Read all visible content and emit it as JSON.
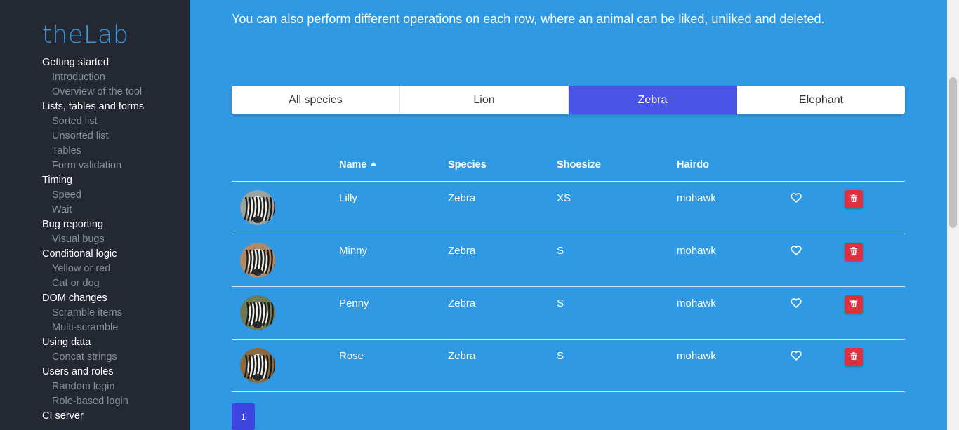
{
  "brand": "theLab",
  "nav": [
    {
      "section": "Getting started",
      "items": [
        "Introduction",
        "Overview of the tool"
      ]
    },
    {
      "section": "Lists, tables and forms",
      "items": [
        "Sorted list",
        "Unsorted list",
        "Tables",
        "Form validation"
      ]
    },
    {
      "section": "Timing",
      "items": [
        "Speed",
        "Wait"
      ]
    },
    {
      "section": "Bug reporting",
      "items": [
        "Visual bugs"
      ]
    },
    {
      "section": "Conditional logic",
      "items": [
        "Yellow or red",
        "Cat or dog"
      ]
    },
    {
      "section": "DOM changes",
      "items": [
        "Scramble items",
        "Multi-scramble"
      ]
    },
    {
      "section": "Using data",
      "items": [
        "Concat strings"
      ]
    },
    {
      "section": "Users and roles",
      "items": [
        "Random login",
        "Role-based login"
      ]
    },
    {
      "section": "CI server",
      "items": []
    }
  ],
  "intro": "You can also perform different operations on each row, where an animal can be liked, unliked and deleted.",
  "tabs": [
    {
      "label": "All species",
      "active": false
    },
    {
      "label": "Lion",
      "active": false
    },
    {
      "label": "Zebra",
      "active": true
    },
    {
      "label": "Elephant",
      "active": false
    }
  ],
  "table": {
    "headers": {
      "name": "Name",
      "species": "Species",
      "shoesize": "Shoesize",
      "hairdo": "Hairdo"
    },
    "sort": {
      "column": "name",
      "direction": "ascending"
    },
    "rows": [
      {
        "name": "Lilly",
        "species": "Zebra",
        "shoesize": "XS",
        "hairdo": "mohawk"
      },
      {
        "name": "Minny",
        "species": "Zebra",
        "shoesize": "S",
        "hairdo": "mohawk"
      },
      {
        "name": "Penny",
        "species": "Zebra",
        "shoesize": "S",
        "hairdo": "mohawk"
      },
      {
        "name": "Rose",
        "species": "Zebra",
        "shoesize": "S",
        "hairdo": "mohawk"
      }
    ]
  },
  "pagination": {
    "current": "1"
  },
  "icons": {
    "like": "heart-outline-icon",
    "delete": "trash-icon"
  },
  "colors": {
    "background": "#2f99e3",
    "sidebar": "#242833",
    "brand": "#2f99e3",
    "active_tab": "#4a55e8",
    "delete": "#e0303f",
    "pager": "#3f45e0"
  }
}
